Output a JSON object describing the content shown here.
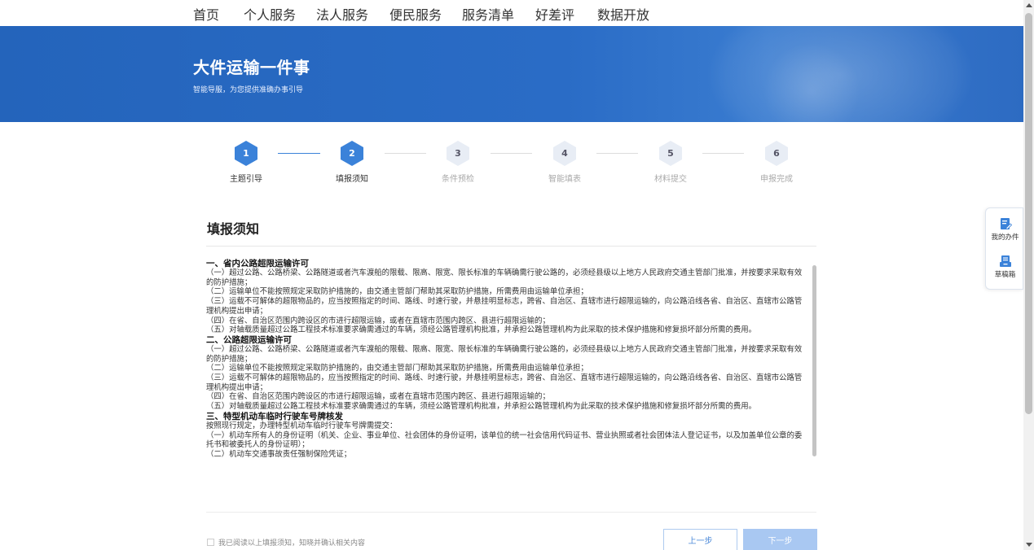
{
  "nav": {
    "items": [
      "首页",
      "个人服务",
      "法人服务",
      "便民服务",
      "服务清单",
      "好差评",
      "数据开放"
    ]
  },
  "banner": {
    "title": "大件运输一件事",
    "subtitle": "智能导服，为您提供准确办事引导"
  },
  "steps": [
    {
      "num": "1",
      "label": "主题引导",
      "state": "done"
    },
    {
      "num": "2",
      "label": "填报须知",
      "state": "current"
    },
    {
      "num": "3",
      "label": "条件预检",
      "state": "todo"
    },
    {
      "num": "4",
      "label": "智能填表",
      "state": "todo"
    },
    {
      "num": "5",
      "label": "材料提交",
      "state": "todo"
    },
    {
      "num": "6",
      "label": "申报完成",
      "state": "todo"
    }
  ],
  "colors": {
    "primary": "#3b82d9",
    "banner": "#2866bf",
    "inactive_step": "#e8edf5",
    "next_disabled": "#a9c8f2"
  },
  "section": {
    "title": "填报须知"
  },
  "notice": {
    "lines": [
      {
        "type": "h",
        "text": "一、省内公路超限运输许可"
      },
      {
        "type": "p",
        "text": "（一）超过公路、公路桥梁、公路隧道或者汽车渡船的限载、限高、限宽、限长标准的车辆确需行驶公路的，必须经县级以上地方人民政府交通主管部门批准，并按要求采取有效的防护措施；"
      },
      {
        "type": "p",
        "text": "（二）运输单位不能按照规定采取防护措施的，由交通主管部门帮助其采取防护措施，所需费用由运输单位承担；"
      },
      {
        "type": "p",
        "text": "（三）运载不可解体的超限物品的，应当按照指定的时间、路线、时速行驶，并悬挂明显标志，跨省、自治区、直辖市进行超限运输的，向公路沿线各省、自治区、直辖市公路管理机构提出申请；"
      },
      {
        "type": "p",
        "text": "（四）在省、自治区范围内跨设区的市进行超限运输，或者在直辖市范围内跨区、县进行超限运输的；"
      },
      {
        "type": "p",
        "text": "（五）对轴载质量超过公路工程技术标准要求确需通过的车辆，须经公路管理机构批准，并承担公路管理机构为此采取的技术保护措施和修复损坏部分所需的费用。"
      },
      {
        "type": "h",
        "text": "二、公路超限运输许可"
      },
      {
        "type": "p",
        "text": "（一）超过公路、公路桥梁、公路隧道或者汽车渡船的限载、限高、限宽、限长标准的车辆确需行驶公路的，必须经县级以上地方人民政府交通主管部门批准，并按要求采取有效的防护措施；"
      },
      {
        "type": "p",
        "text": "（二）运输单位不能按照规定采取防护措施的，由交通主管部门帮助其采取防护措施，所需费用由运输单位承担；"
      },
      {
        "type": "p",
        "text": "（三）运载不可解体的超限物品的，应当按照指定的时间、路线、时速行驶，并悬挂明显标志，跨省、自治区、直辖市进行超限运输的，向公路沿线各省、自治区、直辖市公路管理机构提出申请；"
      },
      {
        "type": "p",
        "text": "（四）在省、自治区范围内跨设区的市进行超限运输，或者在直辖市范围内跨区、县进行超限运输的；"
      },
      {
        "type": "p",
        "text": "（五）对轴载质量超过公路工程技术标准要求确需通过的车辆，须经公路管理机构批准，并承担公路管理机构为此采取的技术保护措施和修复损坏部分所需的费用。"
      },
      {
        "type": "h",
        "text": "三、特型机动车临时行驶车号牌核发"
      },
      {
        "type": "p",
        "text": "按照现行规定，办理特型机动车临时行驶车号牌需提交："
      },
      {
        "type": "p",
        "text": "（一）机动车所有人的身份证明（机关、企业、事业单位、社会团体的身份证明，该单位的统一社会信用代码证书、营业执照或者社会团体法人登记证书，以及加盖单位公章的委托书和被委托人的身份证明）；"
      },
      {
        "type": "p",
        "text": "（二）机动车交通事故责任强制保险凭证；"
      }
    ]
  },
  "footer": {
    "agree_text": "我已阅读以上填报须知，知晓并确认相关内容",
    "prev_label": "上一步",
    "next_label": "下一步"
  },
  "float_widget": {
    "items": [
      {
        "label": "我的办件",
        "icon": "edit-doc-icon"
      },
      {
        "label": "草稿箱",
        "icon": "draft-box-icon"
      }
    ]
  }
}
